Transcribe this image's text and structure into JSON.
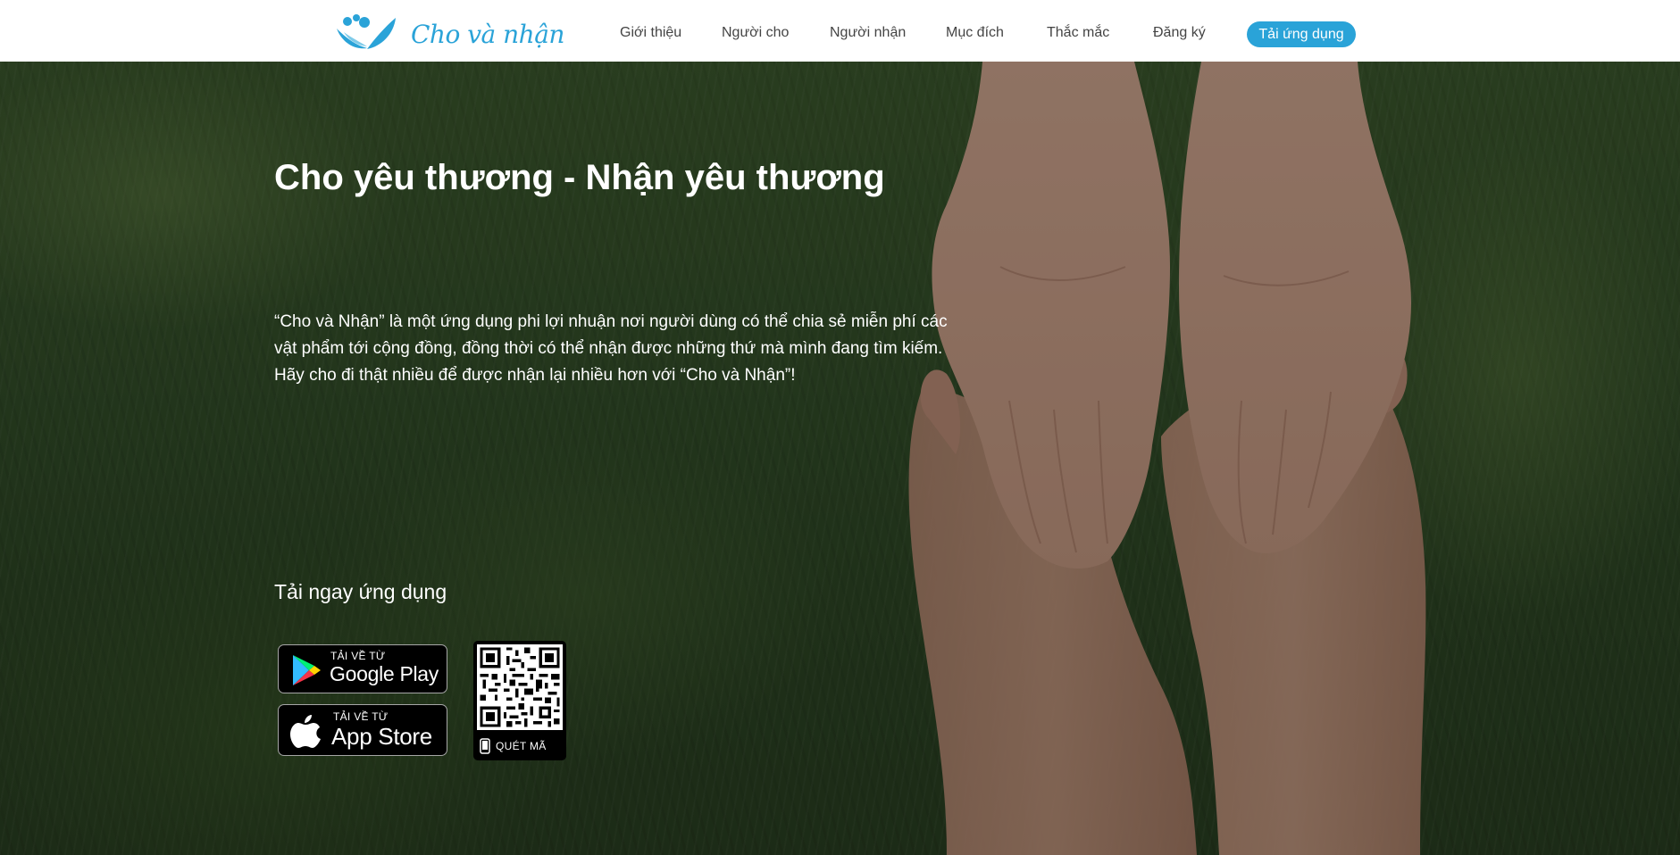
{
  "brand": {
    "name": "Cho và nhận",
    "accent_color": "#2aa3d8",
    "logo_icon": "hands-heart-icon"
  },
  "nav": {
    "items": [
      {
        "label": "Giới thiệu"
      },
      {
        "label": "Người cho"
      },
      {
        "label": "Người nhận"
      },
      {
        "label": "Mục đích"
      },
      {
        "label": "Thắc mắc"
      },
      {
        "label": "Đăng ký"
      }
    ],
    "cta_label": "Tải ứng dụng"
  },
  "hero": {
    "title": "Cho yêu thương - Nhận yêu thương",
    "description_lines": [
      "“Cho và Nhận” là một ứng dụng phi lợi nhuận nơi người dùng có thể chia sẻ miễn phí các vật phẩm tới cộng đồng, đồng thời có thể nhận được những thứ mà mình đang tìm kiếm.",
      "Hãy cho đi thật nhiều để được nhận lại nhiều hơn với “Cho và Nhận”!"
    ],
    "background": "open-hands-on-grass"
  },
  "download": {
    "title": "Tải ngay ứng dụng",
    "google_play": {
      "small": "TẢI VỀ TỪ",
      "big": "Google Play",
      "icon": "google-play-icon"
    },
    "app_store": {
      "small": "TẢI VỀ TỪ",
      "big": "App Store",
      "icon": "apple-icon"
    },
    "qr": {
      "label": "QUÉT MÃ",
      "icon": "phone-icon"
    }
  }
}
